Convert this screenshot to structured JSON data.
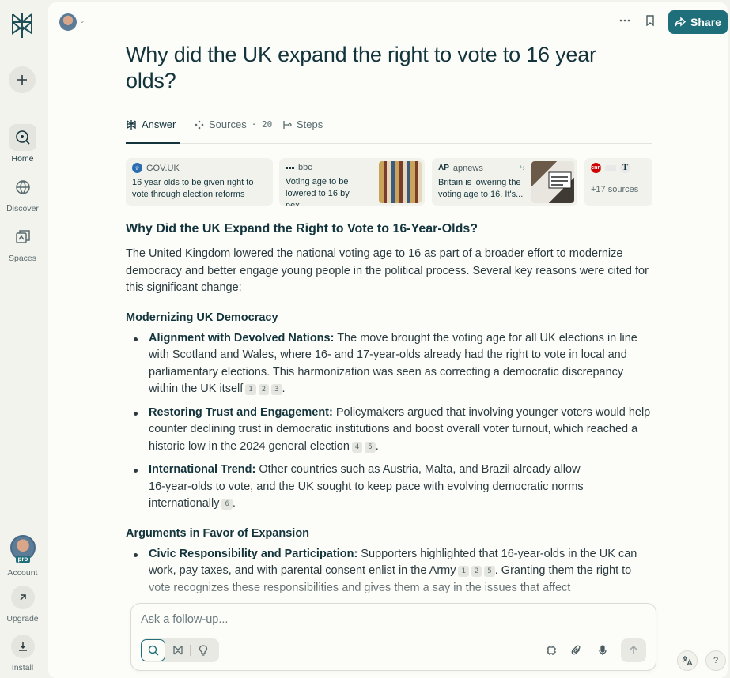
{
  "sidebar": {
    "logo_icon": "perplexity-logo-icon",
    "new_thread_icon": "plus-icon",
    "nav": [
      {
        "label": "Home",
        "icon": "search-icon",
        "active": true
      },
      {
        "label": "Discover",
        "icon": "globe-icon",
        "active": false
      },
      {
        "label": "Spaces",
        "icon": "spaces-icon",
        "active": false
      }
    ],
    "account": {
      "label": "Account",
      "badge": "pro"
    },
    "upgrade": {
      "label": "Upgrade",
      "icon": "arrow-up-right-icon"
    },
    "install": {
      "label": "Install",
      "icon": "download-icon"
    }
  },
  "header": {
    "share_label": "Share",
    "more_icon": "more-icon",
    "bookmark_icon": "bookmark-icon"
  },
  "thread": {
    "title": "Why did the UK expand the right to vote to 16 year olds?"
  },
  "tabs": [
    {
      "label": "Answer",
      "icon": "answer-icon",
      "active": true
    },
    {
      "label": "Sources",
      "count": "20",
      "icon": "sources-icon",
      "active": false
    },
    {
      "label": "Steps",
      "icon": "steps-icon",
      "active": false
    }
  ],
  "sources": [
    {
      "site": "GOV.UK",
      "title": "16 year olds to be given right to vote through election reforms"
    },
    {
      "site": "bbc",
      "title": "Voting age to be lowered to 16 by nex..."
    },
    {
      "site": "apnews",
      "title": "Britain is lowering the voting age to 16. It's..."
    },
    {
      "more_label": "+17 sources"
    }
  ],
  "answer": {
    "heading": "Why Did the UK Expand the Right to Vote to 16-Year-Olds?",
    "intro": "The United Kingdom lowered the national voting age to 16 as part of a broader effort to modernize democracy and better engage young people in the political process. Several key reasons were cited for this significant change:",
    "section1": {
      "title": "Modernizing UK Democracy",
      "items": [
        {
          "bold": "Alignment with Devolved Nations:",
          "text": " The move brought the voting age for all UK elections in line with Scotland and Wales, where 16- and 17-year-olds already had the right to vote in local and parliamentary elections. This harmonization was seen as correcting a democratic discrepancy within the UK itself",
          "cites": [
            "1",
            "2",
            "3"
          ],
          "end": "."
        },
        {
          "bold": "Restoring Trust and Engagement:",
          "text": " Policymakers argued that involving younger voters would help counter declining trust in democratic institutions and boost overall voter turnout, which reached a historic low in the 2024 general election",
          "cites": [
            "4",
            "5"
          ],
          "end": "."
        },
        {
          "bold": "International Trend:",
          "text": " Other countries such as Austria, Malta, and Brazil already allow 16-year-olds to vote, and the UK sought to keep pace with evolving democratic norms internationally",
          "cites": [
            "6"
          ],
          "end": "."
        }
      ]
    },
    "section2": {
      "title": "Arguments in Favor of Expansion",
      "items": [
        {
          "bold": "Civic Responsibility and Participation:",
          "text": " Supporters highlighted that 16-year-olds in the UK can work, pay taxes, and with parental consent enlist in the Army",
          "cites": [
            "1",
            "2",
            "5"
          ],
          "after": ". Granting them the right to vote recognizes these responsibilities and gives them a say in the issues that affect"
        }
      ]
    }
  },
  "followup": {
    "placeholder": "Ask a follow-up...",
    "modes": [
      "search-icon",
      "research-icon",
      "lightbulb-icon"
    ],
    "tools": [
      "chip-icon",
      "paperclip-icon",
      "microphone-icon"
    ],
    "submit_icon": "arrow-up-icon"
  },
  "corner": {
    "translate_icon": "translate-icon",
    "help_label": "?"
  },
  "colors": {
    "accent": "#1f6f7a",
    "text": "#13343b",
    "background": "#fcfcf9",
    "sidebar": "#f3f3ee"
  }
}
